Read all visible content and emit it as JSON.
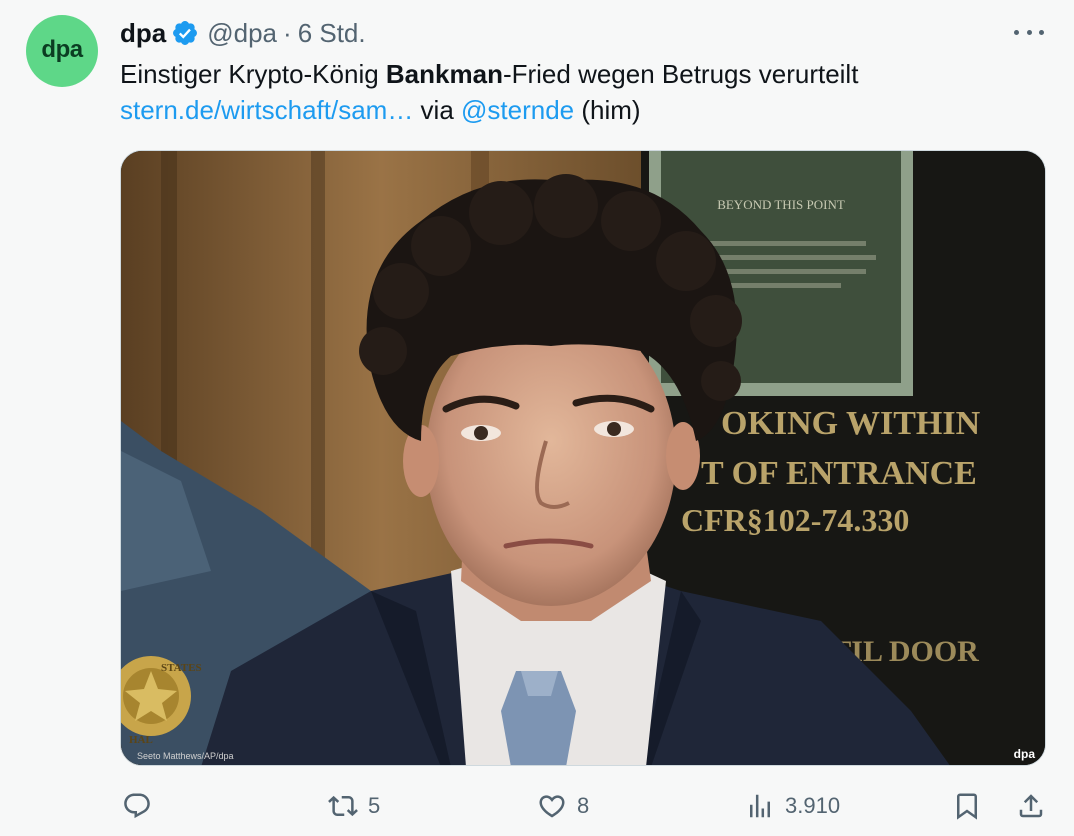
{
  "author": {
    "avatar_text": "dpa",
    "name": "dpa",
    "handle": "@dpa",
    "separator": "·",
    "time": "6 Std."
  },
  "tweet": {
    "text_part1": "Einstiger Krypto-König ",
    "text_bold": "Bankman",
    "text_part2": "-Fried wegen Betrugs verurteilt",
    "link_text": "stern.de/wirtschaft/sam…",
    "via_text": " via ",
    "mention": "@sternde",
    "pronoun": " (him)"
  },
  "media": {
    "credit": "Seeto Matthews/AP/dpa",
    "watermark": "dpa",
    "sign_lines": [
      "OKING WITHIN",
      "T OF ENTRANCE",
      "CFR§102-74.330",
      "T UNTIL DOOR"
    ],
    "plaque_text": "BEYOND THIS POINT",
    "badge_text_top": "STATES",
    "badge_text_bottom": "HAL"
  },
  "actions": {
    "reply_count": "",
    "retweet_count": "5",
    "like_count": "8",
    "views_count": "3.910"
  },
  "colors": {
    "accent": "#1d9bf0",
    "avatar_bg": "#5ed788",
    "muted": "#536471",
    "background": "#f7f8f8"
  }
}
